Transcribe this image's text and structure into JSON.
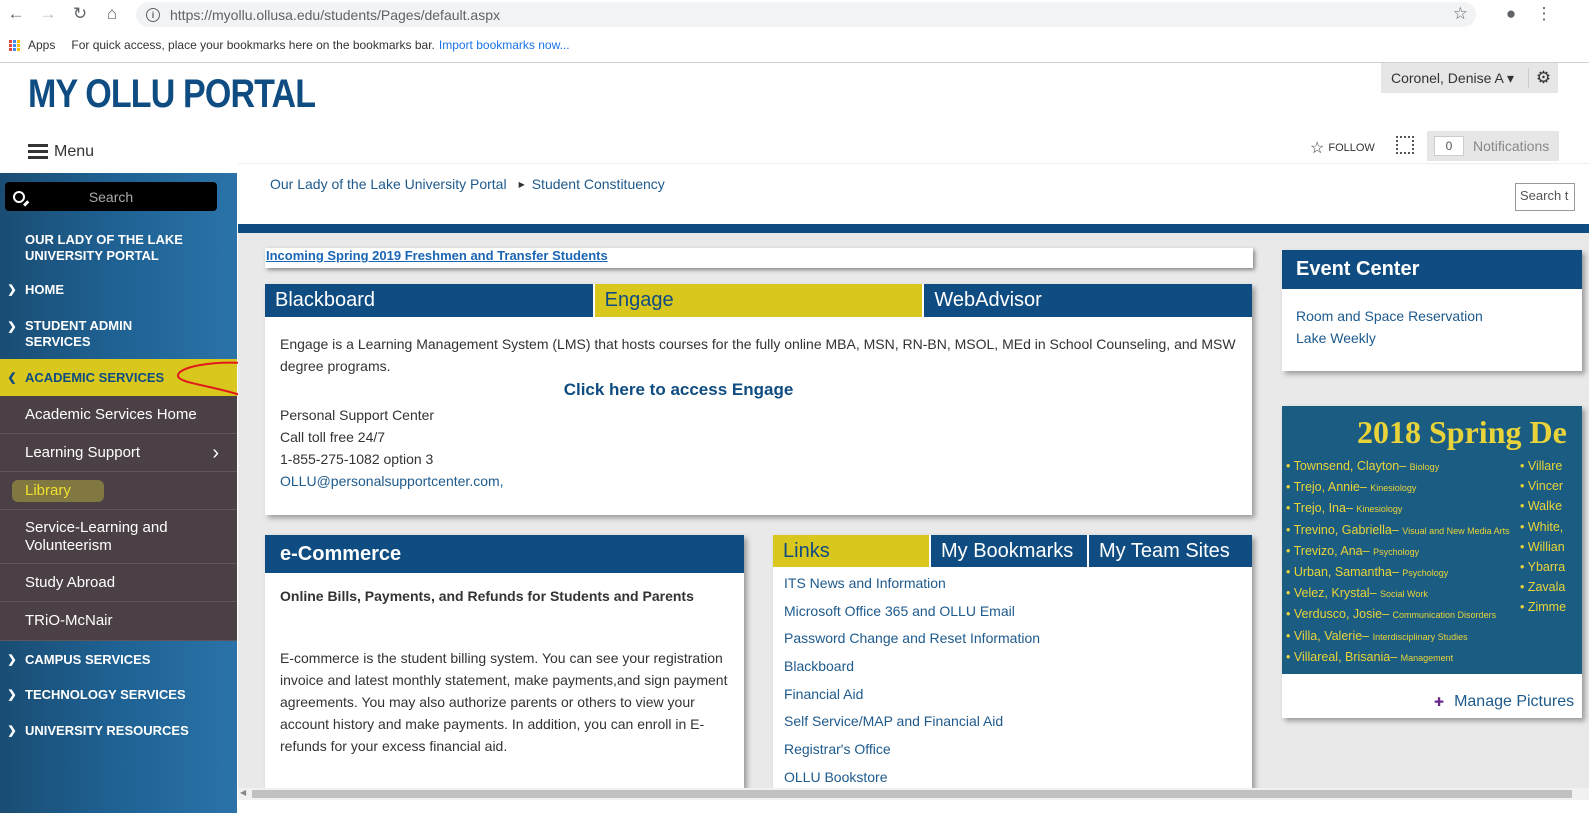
{
  "browser": {
    "url": "https://myollu.ollusa.edu/students/Pages/default.aspx",
    "bookmarks_apps": "Apps",
    "bookmarks_hint": "For quick access, place your bookmarks here on the bookmarks bar.",
    "bookmarks_import": "Import bookmarks now..."
  },
  "header": {
    "title": "MY OLLU PORTAL",
    "menu_label": "Menu",
    "user_name": "Coronel, Denise A ▾",
    "follow_label": "FOLLOW",
    "notif_count": "0",
    "notif_label": "Notifications"
  },
  "sidebar": {
    "search_placeholder": "Search",
    "portal_link": "OUR LADY OF THE LAKE UNIVERSITY PORTAL",
    "home": "HOME",
    "student_admin": "STUDENT ADMIN SERVICES",
    "academic": "ACADEMIC SERVICES",
    "sub": {
      "home": "Academic Services Home",
      "learning": "Learning Support",
      "library": "Library",
      "service": "Service-Learning and Volunteerism",
      "abroad": "Study Abroad",
      "trio": "TRiO-McNair"
    },
    "campus": "CAMPUS SERVICES",
    "tech": "TECHNOLOGY SERVICES",
    "resources": "UNIVERSITY RESOURCES"
  },
  "breadcrumb": {
    "root": "Our Lady of the Lake University Portal",
    "current": "Student Constituency"
  },
  "search_right": "Search t",
  "incoming_link": "Incoming Spring 2019 Freshmen and Transfer Students",
  "tabs": {
    "t1": "Blackboard",
    "t2": "Engage",
    "t3": "WebAdvisor",
    "desc": "Engage is a Learning Management System (LMS) that hosts courses for the fully online MBA, MSN, RN-BN, MSOL, MEd in School Counseling, and MSW degree programs.",
    "cta": "Click here to access Engage",
    "support1": "Personal Support Center",
    "support2": "Call toll free 24/7",
    "support3": "1-855-275-1082 option 3",
    "email": "OLLU@personalsupportcenter.com,"
  },
  "ecommerce": {
    "title": "e-Commerce",
    "subtitle": "Online Bills, Payments, and Refunds for Students and Parents",
    "body": "E-commerce is the student billing system. You can see your registration invoice and latest monthly statement, make payments,and sign payment agreements. You may also authorize parents or others to view your account history and make payments. In addition, you can enroll in E-refunds for your excess financial aid."
  },
  "links": {
    "tab1": "Links",
    "tab2": "My Bookmarks",
    "tab3": "My Team Sites",
    "items": [
      "ITS News and Information",
      "Microsoft Office 365 and OLLU Email",
      "Password Change and Reset Information",
      "Blackboard",
      "Financial Aid",
      "Self Service/MAP and Financial Aid",
      "Registrar's Office",
      "OLLU Bookstore"
    ]
  },
  "event": {
    "title": "Event Center",
    "link1": "Room and Space Reservation",
    "link2": "Lake Weekly"
  },
  "deans": {
    "title": "2018 Spring De",
    "col1": [
      {
        "name": "• Townsend, Clayton– ",
        "major": "Biology"
      },
      {
        "name": "• Trejo, Annie– ",
        "major": "Kinesiology"
      },
      {
        "name": "• Trejo, Ina– ",
        "major": "Kinesiology"
      },
      {
        "name": "• Trevino, Gabriella– ",
        "major": "Visual and New Media Arts"
      },
      {
        "name": "• Trevizo, Ana– ",
        "major": "Psychology"
      },
      {
        "name": "• Urban, Samantha– ",
        "major": "Psychology"
      },
      {
        "name": "• Velez, Krystal– ",
        "major": "Social Work"
      },
      {
        "name": "• Verdusco, Josie– ",
        "major": "Communication Disorders"
      },
      {
        "name": "• Villa, Valerie– ",
        "major": "Interdisciplinary Studies"
      },
      {
        "name": "• Villareal, Brisania– ",
        "major": "Management"
      }
    ],
    "col2": [
      "• Villare",
      "• Vincer",
      "• Walke",
      "• White,",
      "• Willian",
      "• Ybarra",
      "• Zavala",
      "• Zimme"
    ],
    "manage": "Manage Pictures"
  }
}
